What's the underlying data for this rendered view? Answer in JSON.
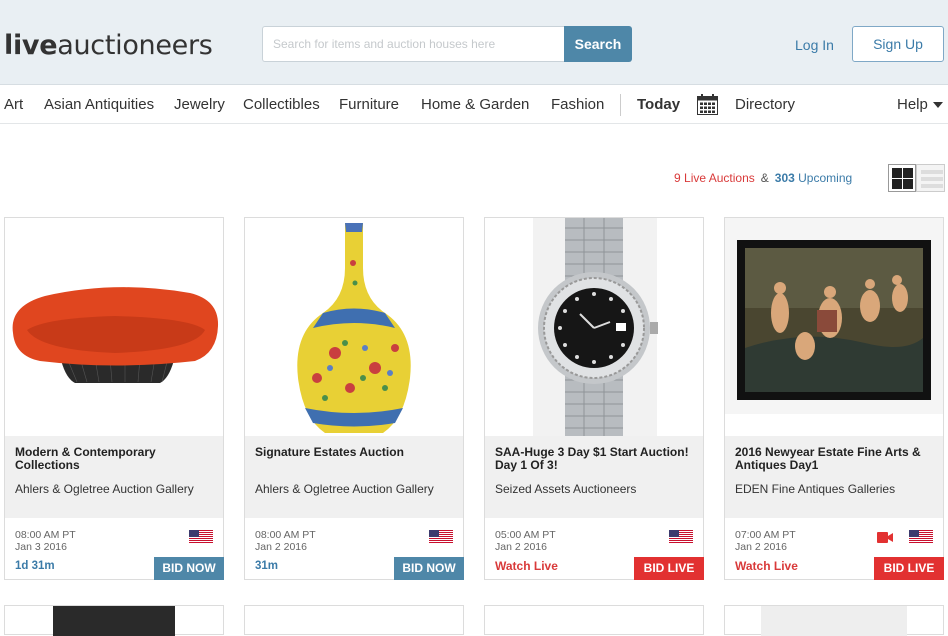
{
  "header": {
    "logo_bold": "live",
    "logo_rest": "auctioneers",
    "search_placeholder": "Search for items and auction houses here",
    "search_button": "Search",
    "login": "Log In",
    "signup": "Sign Up"
  },
  "nav": {
    "items": [
      "Art",
      "Asian Antiquities",
      "Jewelry",
      "Collectibles",
      "Furniture",
      "Home & Garden",
      "Fashion"
    ],
    "today": "Today",
    "directory": "Directory",
    "help": "Help"
  },
  "counts": {
    "live_number": "9",
    "live_label": "Live Auctions",
    "amp": "&",
    "upcoming_number": "303",
    "upcoming_label": "Upcoming"
  },
  "cards": [
    {
      "title": "Modern & Contemporary Collections",
      "house": "Ahlers & Ogletree Auction Gallery",
      "time": "08:00 AM PT",
      "date": "Jan 3 2016",
      "status": "1d 31m",
      "button": "BID NOW",
      "image": "orange-sofa"
    },
    {
      "title": "Signature Estates Auction",
      "house": "Ahlers & Ogletree Auction Gallery",
      "time": "08:00 AM PT",
      "date": "Jan 2 2016",
      "status": "31m",
      "button": "BID NOW",
      "image": "yellow-vase"
    },
    {
      "title": "SAA-Huge 3 Day $1 Start Auction! Day 1 Of 3!",
      "house": "Seized Assets Auctioneers",
      "time": "05:00 AM PT",
      "date": "Jan 2 2016",
      "status": "Watch Live",
      "button": "BID LIVE",
      "image": "rolex-watch"
    },
    {
      "title": "2016 Newyear Estate Fine Arts & Antiques Day1",
      "house": "EDEN Fine Antiques Galleries",
      "time": "07:00 AM PT",
      "date": "Jan 2 2016",
      "status": "Watch Live",
      "button": "BID LIVE",
      "image": "framed-painting"
    }
  ],
  "colors": {
    "accent_blue": "#4e87a8",
    "live_red": "#e23131"
  }
}
